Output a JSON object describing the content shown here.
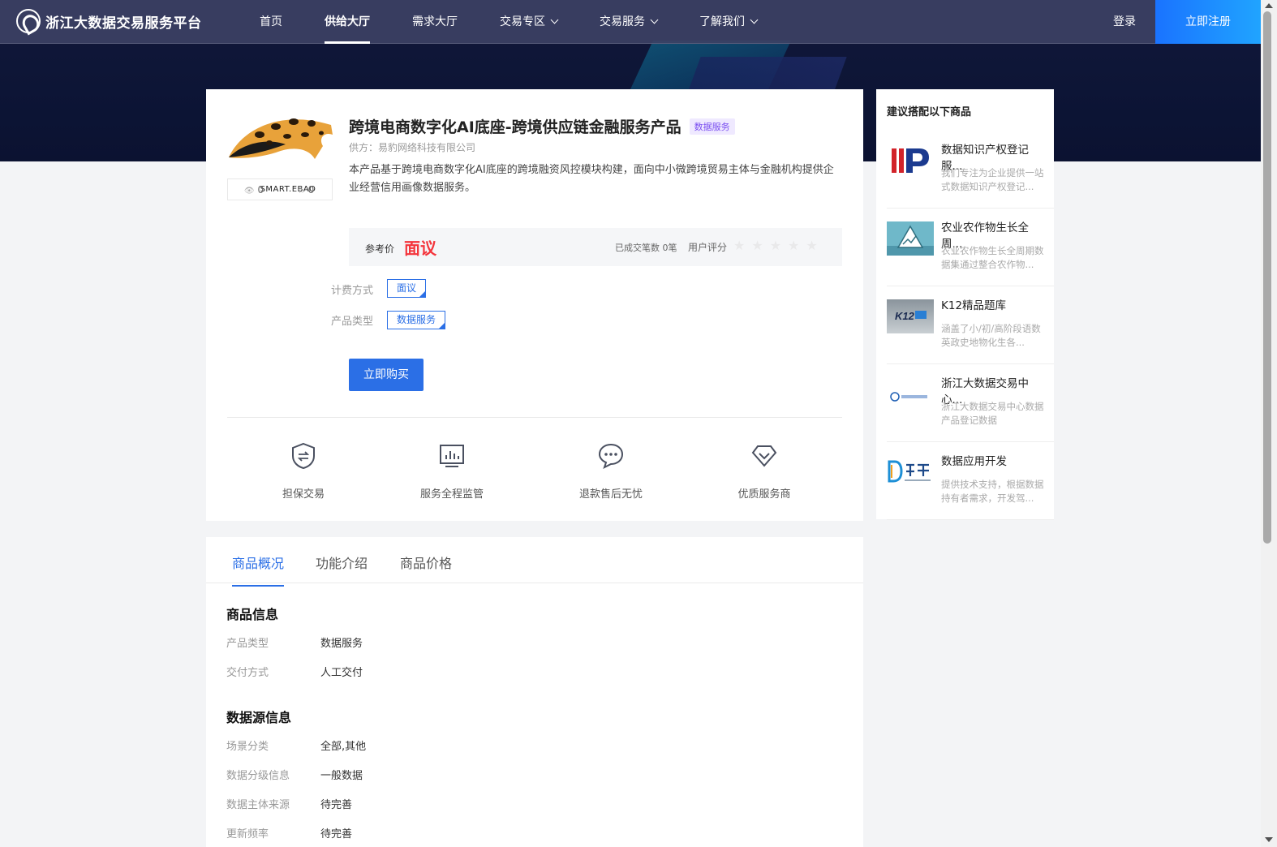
{
  "nav": {
    "logo_text": "浙江大数据交易服务平台",
    "menu": [
      {
        "label": "首页",
        "active": false,
        "dropdown": false
      },
      {
        "label": "供给大厅",
        "active": true,
        "dropdown": false
      },
      {
        "label": "需求大厅",
        "active": false,
        "dropdown": false
      },
      {
        "label": "交易专区",
        "active": false,
        "dropdown": true
      },
      {
        "label": "交易服务",
        "active": false,
        "dropdown": true
      },
      {
        "label": "了解我们",
        "active": false,
        "dropdown": true
      }
    ],
    "login": "登录",
    "register": "立即注册"
  },
  "product": {
    "brand": "SMART.EBAO",
    "views": "0",
    "favorites": "0",
    "title": "跨境电商数字化AI底座-跨境供应链金融服务产品",
    "tag": "数据服务",
    "supplier": "供方：易豹网络科技有限公司",
    "description": "本产品基于跨境电商数字化AI底座的跨境融资风控模块构建，面向中小微跨境贸易主体与金融机构提供企业经营信用画像数据服务。",
    "price_label": "参考价",
    "price_value": "面议",
    "deals": "已成交笔数 0笔",
    "rating_label": "用户评分",
    "billing_label": "计费方式",
    "billing_value": "面议",
    "type_label": "产品类型",
    "type_value": "数据服务",
    "buy_button": "立即购买"
  },
  "guarantees": [
    {
      "label": "担保交易",
      "icon": "shield-exchange-icon"
    },
    {
      "label": "服务全程监管",
      "icon": "monitor-chart-icon"
    },
    {
      "label": "退款售后无忧",
      "icon": "chat-bubble-icon"
    },
    {
      "label": "优质服务商",
      "icon": "diamond-icon"
    }
  ],
  "recommend": {
    "title": "建议搭配以下商品",
    "items": [
      {
        "name": "数据知识产权登记服...",
        "desc": "我们专注为企业提供一站式数据知识产权登记...",
        "thumb": "ip-logo"
      },
      {
        "name": "农业农作物生长全周...",
        "desc": "农业农作物生长全周期数据集通过整合农作物...",
        "thumb": "agri-logo"
      },
      {
        "name": "K12精品题库",
        "desc": "涵盖了小/初/高阶段语数英政史地物化生各...",
        "thumb": "k12-logo"
      },
      {
        "name": "浙江大数据交易中心...",
        "desc": "浙江大数据交易中心数据产品登记数据",
        "thumb": "zj-logo"
      },
      {
        "name": "数据应用开发",
        "desc": "提供技术支持，根据数据持有者需求，开发驾...",
        "thumb": "dongyang-logo"
      }
    ]
  },
  "details": {
    "tabs": [
      {
        "label": "商品概况",
        "active": true
      },
      {
        "label": "功能介绍",
        "active": false
      },
      {
        "label": "商品价格",
        "active": false
      }
    ],
    "section1_title": "商品信息",
    "section1": [
      {
        "k": "产品类型",
        "v": "数据服务"
      },
      {
        "k": "交付方式",
        "v": "人工交付"
      }
    ],
    "section2_title": "数据源信息",
    "section2": [
      {
        "k": "场景分类",
        "v": "全部,其他"
      },
      {
        "k": "数据分级信息",
        "v": "一般数据"
      },
      {
        "k": "数据主体来源",
        "v": "待完善"
      },
      {
        "k": "更新频率",
        "v": "待完善"
      }
    ]
  },
  "colors": {
    "accent": "#2b6fe6",
    "price": "#f4343b",
    "tag_purple": "#7a4ef0"
  }
}
